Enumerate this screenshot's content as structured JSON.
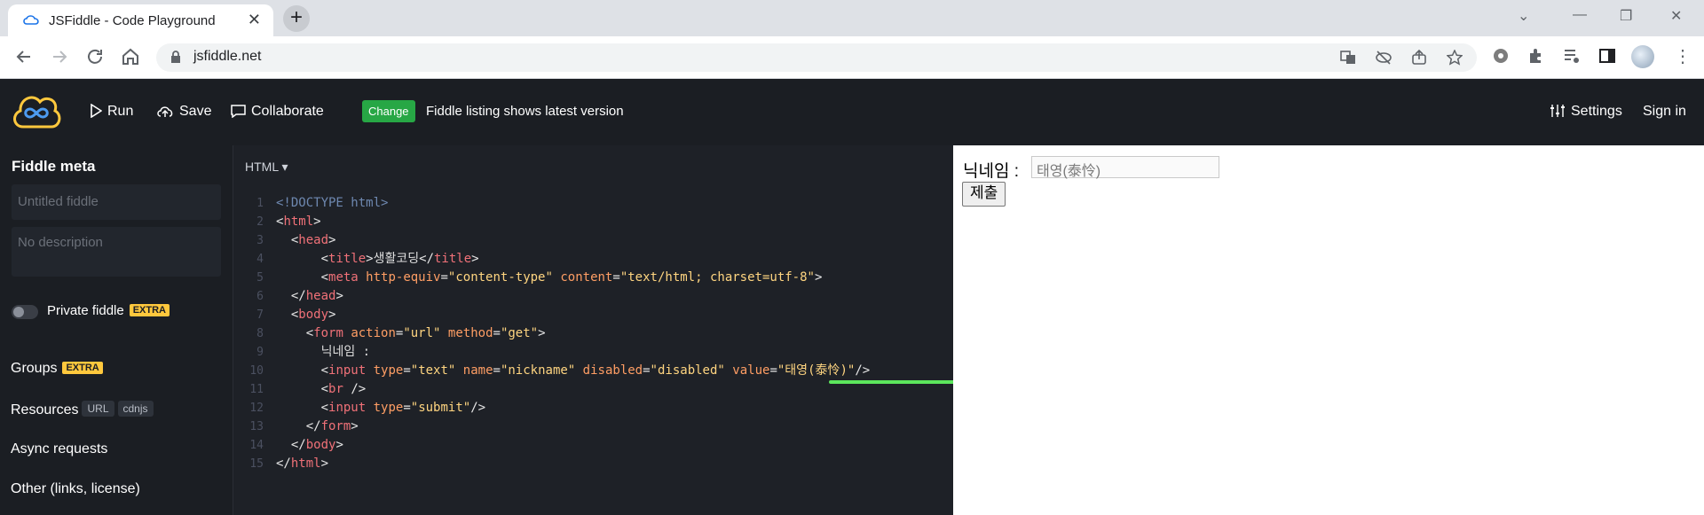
{
  "browser": {
    "tab_title": "JSFiddle - Code Playground",
    "url": "jsfiddle.net"
  },
  "app": {
    "run_label": "Run",
    "save_label": "Save",
    "collaborate_label": "Collaborate",
    "change_badge": "Change",
    "listing_text": "Fiddle listing shows latest version",
    "settings_label": "Settings",
    "signin_label": "Sign in"
  },
  "sidebar": {
    "title": "Fiddle meta",
    "name_placeholder": "Untitled fiddle",
    "description_placeholder": "No description",
    "private_label": "Private fiddle",
    "extra_badge": "EXTRA",
    "groups_label": "Groups",
    "resources_label": "Resources",
    "resources_chips": [
      "URL",
      "cdnjs"
    ],
    "async_label": "Async requests",
    "other_label": "Other (links, license)"
  },
  "editor": {
    "language": "HTML",
    "line_numbers": [
      "1",
      "2",
      "3",
      "4",
      "5",
      "6",
      "7",
      "8",
      "9",
      "10",
      "11",
      "12",
      "13",
      "14",
      "15"
    ]
  },
  "preview": {
    "label": "닉네임 :",
    "input_value": "태영(泰怜)",
    "submit_label": "제출"
  },
  "colors": {
    "app_bg": "#1b1e23",
    "editor_bg": "#1e2127",
    "change_green": "#27a745",
    "extra_yellow": "#ffc83d",
    "underline_green": "#5ce65c"
  }
}
